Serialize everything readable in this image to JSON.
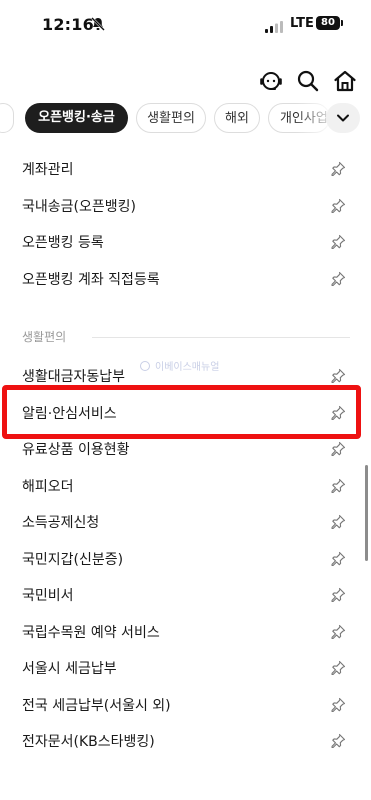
{
  "status_bar": {
    "time": "12:16",
    "network": "LTE",
    "battery": "80"
  },
  "header": {
    "icons": [
      "chatbot-icon",
      "search-icon",
      "home-icon"
    ]
  },
  "tabs": [
    {
      "label": "",
      "state": "cut"
    },
    {
      "label": "오픈뱅킹·송금",
      "state": "active"
    },
    {
      "label": "생활편의",
      "state": "normal"
    },
    {
      "label": "해외",
      "state": "normal"
    },
    {
      "label": "개인사업",
      "state": "normal"
    }
  ],
  "menu_items_top": [
    "계좌관리",
    "국내송금(오픈뱅킹)",
    "오픈뱅킹 등록",
    "오픈뱅킹 계좌 직접등록"
  ],
  "section": {
    "title": "생활편의"
  },
  "watermark": "이베이스매뉴얼",
  "menu_items_life": [
    "생활대금자동납부",
    "알림·안심서비스",
    "유료상품 이용현황",
    "해피오더",
    "소득공제신청",
    "국민지갑(신분증)",
    "국민비서",
    "국립수목원 예약 서비스",
    "서울시 세금납부",
    "전국 세금납부(서울시 외)",
    "전자문서(KB스타뱅킹)"
  ],
  "colors": {
    "highlight": "#ee1111",
    "active_tab": "#1e1e1e"
  }
}
